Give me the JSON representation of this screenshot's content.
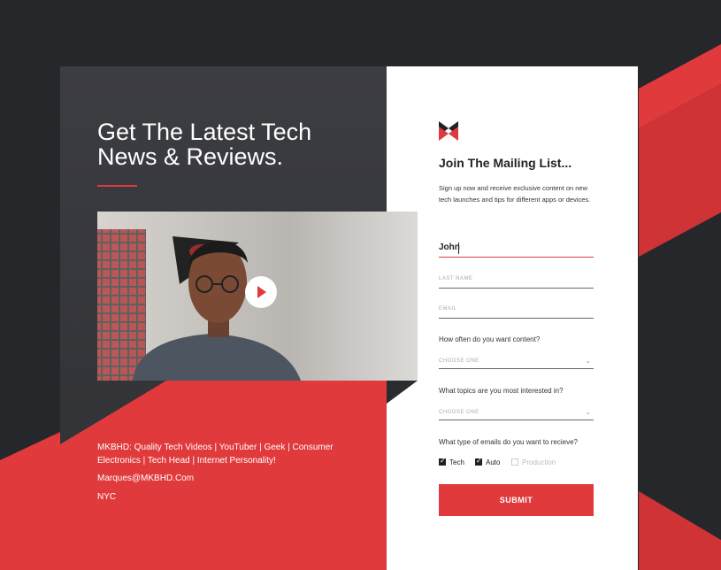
{
  "hero": {
    "headline": "Get The Latest Tech News & Reviews."
  },
  "video": {
    "play_icon": "play-icon"
  },
  "bio": {
    "description": "MKBHD: Quality Tech Videos | YouTuber | Geek | Consumer Electronics | Tech Head | Internet Personality!",
    "email": "Marques@MKBHD.Com",
    "location": "NYC"
  },
  "form": {
    "logo_icon": "mkbhd-logo-icon",
    "title": "Join The Mailing List...",
    "intro": "Sign up now and receive exclusive content on new tech launches and tips for different apps or devices.",
    "first_name": {
      "value": "John"
    },
    "last_name": {
      "placeholder": "LAST NAME"
    },
    "email": {
      "placeholder": "EMAIL"
    },
    "frequency": {
      "question": "How often do you want content?",
      "selected": "CHOOSE ONE"
    },
    "topics": {
      "question": "What topics are you most interested in?",
      "selected": "CHOOSE ONE"
    },
    "email_types": {
      "question": "What type of emails do you want to recieve?",
      "options": [
        {
          "label": "Tech",
          "checked": true
        },
        {
          "label": "Auto",
          "checked": true
        },
        {
          "label": "Production",
          "checked": false
        }
      ]
    },
    "submit_label": "SUBMIT"
  },
  "colors": {
    "accent": "#e03a3c",
    "dark": "#2b2c30",
    "panel_dark": "#3a3b40",
    "white": "#ffffff"
  }
}
